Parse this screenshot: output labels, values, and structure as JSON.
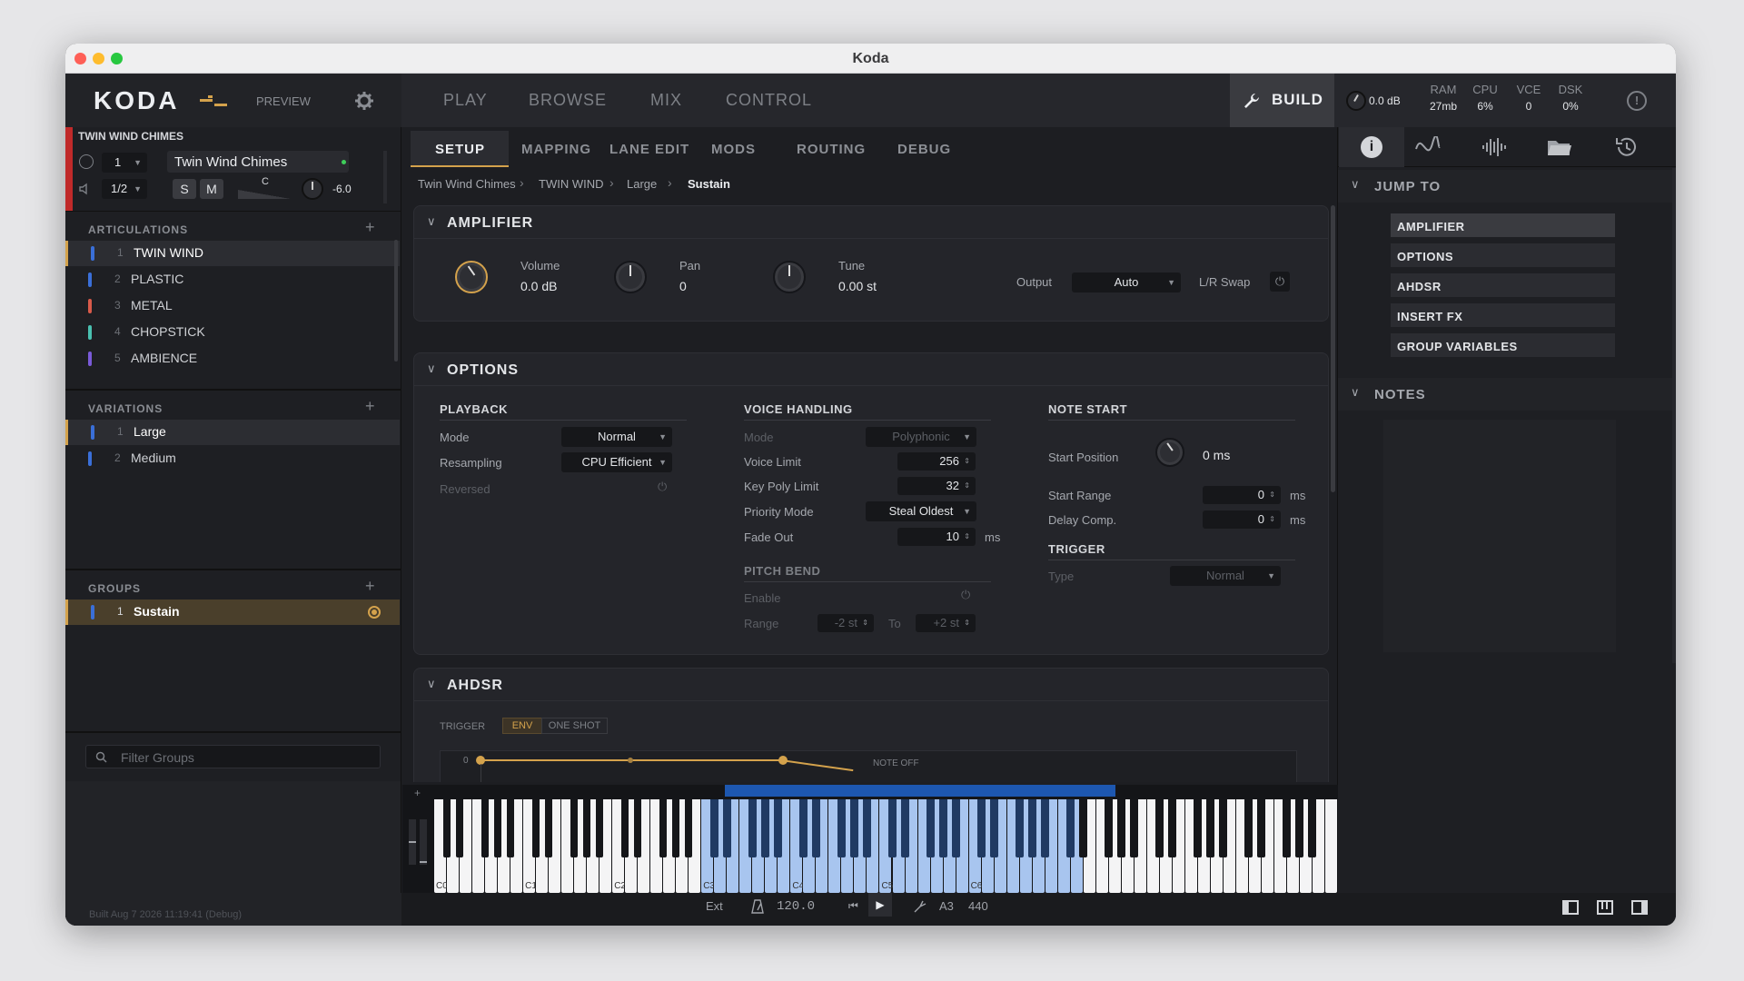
{
  "window_title": "Koda",
  "app": {
    "logo": "KODA",
    "preview": "PREVIEW"
  },
  "main_tabs": [
    "PLAY",
    "BROWSE",
    "MIX",
    "CONTROL"
  ],
  "build_label": "BUILD",
  "master_vol": "0.0 dB",
  "stats": [
    {
      "label": "RAM",
      "value": "27mb"
    },
    {
      "label": "CPU",
      "value": "6%"
    },
    {
      "label": "VCE",
      "value": "0"
    },
    {
      "label": "DSK",
      "value": "0%"
    }
  ],
  "instrument": {
    "header": "TWIN WIND CHIMES",
    "slot": "1",
    "name": "Twin Wind Chimes",
    "division": "1/2",
    "solo": "S",
    "mute": "M",
    "pan_label": "C",
    "volume": "-6.0"
  },
  "articulations": {
    "header": "ARTICULATIONS",
    "items": [
      {
        "num": "1",
        "label": "TWIN WIND",
        "color": "#3a6fd8"
      },
      {
        "num": "2",
        "label": "PLASTIC",
        "color": "#3a6fd8"
      },
      {
        "num": "3",
        "label": "METAL",
        "color": "#d85a4a"
      },
      {
        "num": "4",
        "label": "CHOPSTICK",
        "color": "#4ac0b0"
      },
      {
        "num": "5",
        "label": "AMBIENCE",
        "color": "#7a5ad8"
      }
    ]
  },
  "variations": {
    "header": "VARIATIONS",
    "items": [
      {
        "num": "1",
        "label": "Large",
        "color": "#3a6fd8"
      },
      {
        "num": "2",
        "label": "Medium",
        "color": "#3a6fd8"
      }
    ]
  },
  "groups": {
    "header": "GROUPS",
    "items": [
      {
        "num": "1",
        "label": "Sustain",
        "color": "#3a6fd8"
      }
    ],
    "filter_placeholder": "Filter Groups"
  },
  "build_info": "Built Aug 7 2026 11:19:41 (Debug)",
  "sub_tabs": [
    "SETUP",
    "MAPPING",
    "LANE EDIT",
    "MODS",
    "ROUTING",
    "DEBUG"
  ],
  "breadcrumb": [
    "Twin Wind Chimes",
    "TWIN WIND",
    "Large",
    "Sustain"
  ],
  "amplifier": {
    "title": "AMPLIFIER",
    "volume_label": "Volume",
    "volume_value": "0.0 dB",
    "pan_label": "Pan",
    "pan_value": "0",
    "tune_label": "Tune",
    "tune_value": "0.00 st",
    "output_label": "Output",
    "output_value": "Auto",
    "lr_swap_label": "L/R Swap"
  },
  "options": {
    "title": "OPTIONS",
    "playback": {
      "header": "PLAYBACK",
      "mode_label": "Mode",
      "mode_value": "Normal",
      "resampling_label": "Resampling",
      "resampling_value": "CPU Efficient",
      "reversed_label": "Reversed"
    },
    "voice": {
      "header": "VOICE HANDLING",
      "mode_label": "Mode",
      "mode_value": "Polyphonic",
      "voice_limit_label": "Voice Limit",
      "voice_limit_value": "256",
      "key_poly_label": "Key Poly Limit",
      "key_poly_value": "32",
      "priority_label": "Priority Mode",
      "priority_value": "Steal Oldest",
      "fade_label": "Fade Out",
      "fade_value": "10",
      "fade_unit": "ms"
    },
    "pitch_bend": {
      "header": "PITCH BEND",
      "enable_label": "Enable",
      "range_label": "Range",
      "range_from": "-2 st",
      "to_label": "To",
      "range_to": "+2 st"
    },
    "note_start": {
      "header": "NOTE START",
      "start_pos_label": "Start Position",
      "start_pos_value": "0 ms",
      "start_range_label": "Start Range",
      "start_range_value": "0",
      "start_range_unit": "ms",
      "delay_label": "Delay Comp.",
      "delay_value": "0",
      "delay_unit": "ms"
    },
    "trigger": {
      "header": "TRIGGER",
      "type_label": "Type",
      "type_value": "Normal"
    }
  },
  "ahdsr": {
    "title": "AHDSR",
    "trigger_label": "TRIGGER",
    "env": "ENV",
    "one_shot": "ONE SHOT",
    "zero": "0",
    "note_off": "NOTE OFF"
  },
  "right_panel": {
    "jump_to": "JUMP TO",
    "jump_items": [
      "AMPLIFIER",
      "OPTIONS",
      "AHDSR",
      "INSERT FX",
      "GROUP VARIABLES"
    ],
    "notes": "NOTES"
  },
  "keyboard": {
    "labels": [
      "C0",
      "C1",
      "C2",
      "C3",
      "C4",
      "C5",
      "C6"
    ],
    "plus": "+"
  },
  "transport": {
    "ext": "Ext",
    "tempo": "120.0",
    "note": "A3",
    "tuning": "440"
  },
  "colors": {
    "accent": "#d4a24c",
    "selection_blue": "#1d57b0",
    "key_highlight": "#a8c5ef"
  }
}
